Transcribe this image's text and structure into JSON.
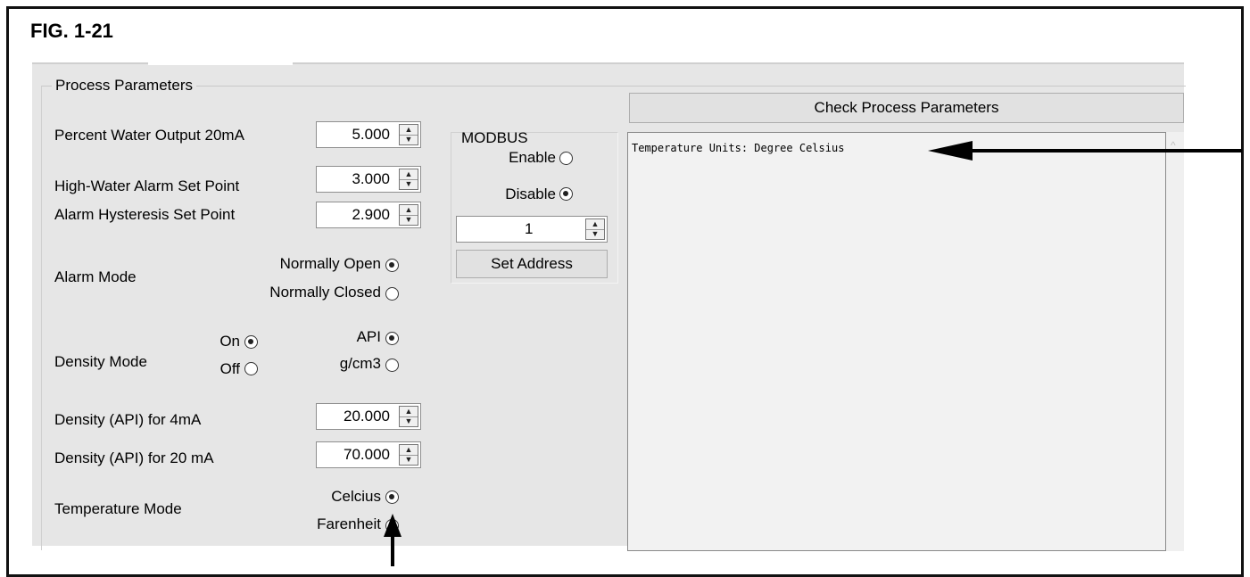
{
  "figure": {
    "title": "FIG. 1-21"
  },
  "process_parameters": {
    "group_label": "Process Parameters",
    "percent_water": {
      "label": "Percent Water Output 20mA",
      "value": "5.000"
    },
    "high_water_alarm": {
      "label": "High-Water Alarm Set Point",
      "value": "3.000"
    },
    "alarm_hysteresis": {
      "label": "Alarm Hysteresis Set Point",
      "value": "2.900"
    },
    "alarm_mode": {
      "label": "Alarm Mode",
      "options": [
        {
          "label": "Normally Open",
          "selected": true
        },
        {
          "label": "Normally Closed",
          "selected": false
        }
      ]
    },
    "density_mode": {
      "label": "Density Mode",
      "state_options": [
        {
          "label": "On",
          "selected": true
        },
        {
          "label": "Off",
          "selected": false
        }
      ],
      "unit_options": [
        {
          "label": "API",
          "selected": true
        },
        {
          "label": "g/cm3",
          "selected": false
        }
      ]
    },
    "density_4ma": {
      "label": "Density (API) for 4mA",
      "value": "20.000"
    },
    "density_20ma": {
      "label": "Density (API) for 20 mA",
      "value": "70.000"
    },
    "temperature_mode": {
      "label": "Temperature Mode",
      "options": [
        {
          "label": "Celcius",
          "selected": true
        },
        {
          "label": "Farenheit",
          "selected": false
        }
      ]
    }
  },
  "modbus": {
    "label": "MODBUS",
    "options": [
      {
        "label": "Enable",
        "selected": false
      },
      {
        "label": "Disable",
        "selected": true
      }
    ],
    "address_value": "1",
    "set_address_label": "Set Address"
  },
  "check_button_label": "Check Process Parameters",
  "output_text": "Temperature Units: Degree Celsius"
}
